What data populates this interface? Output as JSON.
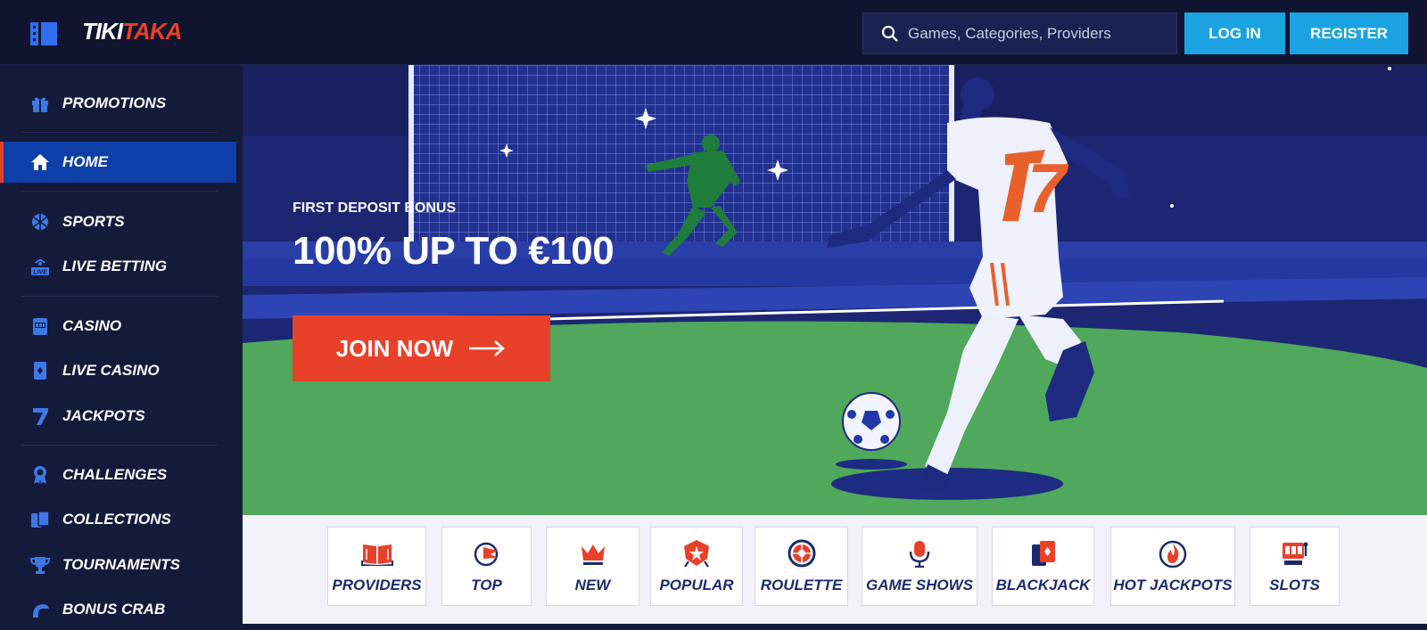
{
  "brand": {
    "name_part1": "TIKI",
    "name_part2": "TAKA"
  },
  "header": {
    "search_placeholder": "Games, Categories, Providers",
    "login_label": "LOG IN",
    "register_label": "REGISTER"
  },
  "sidebar": {
    "items": [
      {
        "label": "PROMOTIONS",
        "icon": "gift-icon"
      },
      {
        "label": "HOME",
        "icon": "home-icon",
        "active": true
      },
      {
        "label": "SPORTS",
        "icon": "ball-icon"
      },
      {
        "label": "LIVE BETTING",
        "icon": "live-icon"
      },
      {
        "label": "CASINO",
        "icon": "slot-machine-icon"
      },
      {
        "label": "LIVE CASINO",
        "icon": "card-icon"
      },
      {
        "label": "JACKPOTS",
        "icon": "seven-icon"
      },
      {
        "label": "CHALLENGES",
        "icon": "medal-icon"
      },
      {
        "label": "COLLECTIONS",
        "icon": "cards-icon"
      },
      {
        "label": "TOURNAMENTS",
        "icon": "trophy-icon"
      },
      {
        "label": "BONUS CRAB",
        "icon": "claw-icon"
      }
    ]
  },
  "hero": {
    "subtitle": "FIRST DEPOSIT BONUS",
    "title": "100% UP TO €100",
    "cta_label": "JOIN NOW",
    "jersey_number": "7"
  },
  "categories": [
    {
      "label": "PROVIDERS",
      "icon": "book-icon"
    },
    {
      "label": "TOP",
      "icon": "flag-icon"
    },
    {
      "label": "NEW",
      "icon": "crown-icon"
    },
    {
      "label": "POPULAR",
      "icon": "star-badge-icon"
    },
    {
      "label": "ROULETTE",
      "icon": "roulette-icon"
    },
    {
      "label": "GAME SHOWS",
      "icon": "microphone-icon"
    },
    {
      "label": "BLACKJACK",
      "icon": "cards-icon"
    },
    {
      "label": "HOT JACKPOTS",
      "icon": "fire-icon"
    },
    {
      "label": "SLOTS",
      "icon": "slot-machine-icon"
    }
  ],
  "colors": {
    "accent": "#e8412a",
    "primary_button": "#1aa3e0",
    "sidebar_active": "#0e3fa8",
    "bg": "#141a3a"
  }
}
